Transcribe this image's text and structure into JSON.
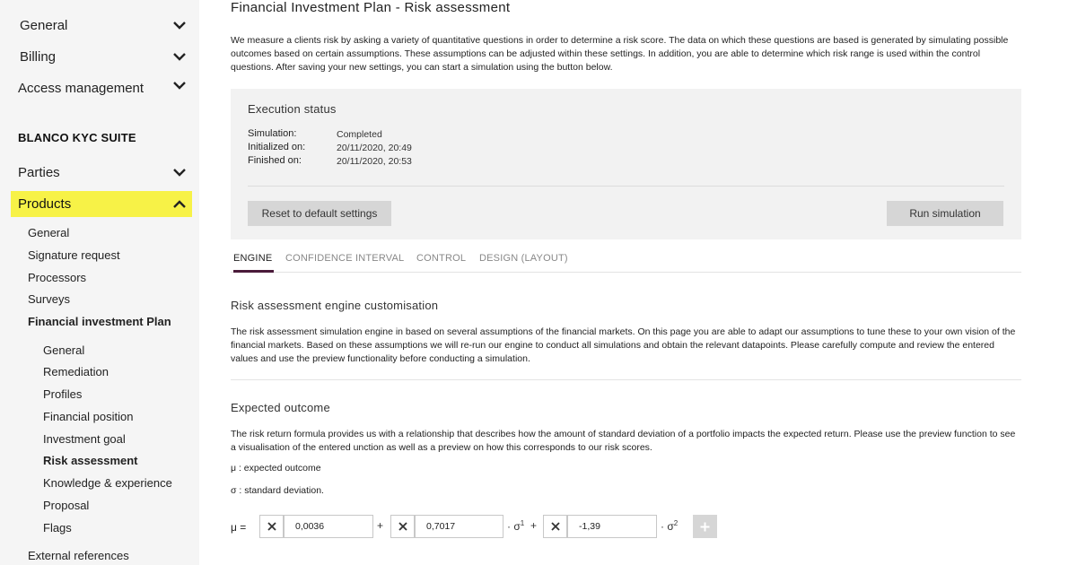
{
  "sidebar": {
    "top_items": [
      {
        "label": "General"
      },
      {
        "label": "Billing"
      },
      {
        "label": "Access management"
      }
    ],
    "suite_title": "BLANCO KYC SUITE",
    "parties": {
      "label": "Parties"
    },
    "products": {
      "label": "Products"
    },
    "product_items": [
      {
        "label": "General"
      },
      {
        "label": "Signature request"
      },
      {
        "label": "Processors"
      },
      {
        "label": "Surveys"
      },
      {
        "label": "Financial investment Plan"
      }
    ],
    "plan_items": [
      {
        "label": "General"
      },
      {
        "label": "Remediation"
      },
      {
        "label": "Profiles"
      },
      {
        "label": "Financial position"
      },
      {
        "label": "Investment goal"
      },
      {
        "label": "Risk assessment"
      },
      {
        "label": "Knowledge & experience"
      },
      {
        "label": "Proposal"
      },
      {
        "label": "Flags"
      }
    ],
    "external_references": {
      "label": "External references"
    },
    "highlight_color": "#f7f247"
  },
  "main": {
    "title": "Financial Investment Plan - Risk assessment",
    "intro": "We measure a clients risk by asking a variety of quantitative questions in order to determine a risk score. The data on which these questions are based is generated by simulating possible outcomes based on certain assumptions. These assumptions can be adjusted within these settings. In addition, you are able to determine which risk range is used within the control questions. After saving your new settings, you can start a simulation using the button below.",
    "execution": {
      "title": "Execution status",
      "rows": [
        {
          "label": "Simulation:",
          "value": "Completed"
        },
        {
          "label": "Initialized on:",
          "value": "20/11/2020, 20:49"
        },
        {
          "label": "Finished on:",
          "value": "20/11/2020, 20:53"
        }
      ],
      "reset_label": "Reset to default settings",
      "run_label": "Run simulation"
    },
    "tabs": [
      {
        "label": "ENGINE"
      },
      {
        "label": "CONFIDENCE INTERVAL"
      },
      {
        "label": "CONTROL"
      },
      {
        "label": "DESIGN (LAYOUT)"
      }
    ],
    "engine_section": {
      "title": "Risk assessment engine customisation",
      "text": "The risk assessment simulation engine in based on several assumptions of the financial markets. On this page you are able to adapt our assumptions to tune these to your own vision of the financial markets. Based on these assumptions we will re-run our engine to conduct all simulations and obtain the relevant datapoints. Please carefully compute and review the entered values and use the preview functionality before conducting a simulation."
    },
    "outcome_section": {
      "title": "Expected outcome",
      "text": "The risk return formula provides us with a relationship that describes how the amount of standard deviation of a portfolio impacts the expected return. Please use the preview function to see a visualisation of the entered unction as well as a preview on how this corresponds to our risk scores.",
      "mu_legend": "μ : expected outcome",
      "sigma_legend": "σ : standard deviation."
    },
    "formula": {
      "mu_eq": "μ =",
      "coef0": "0,0036",
      "coef1": "0,7017",
      "coef2": "-1,39",
      "plus1": "+",
      "term1": "· σ",
      "exp1": "1",
      "plus2": "+",
      "term2": "· σ",
      "exp2": "2"
    },
    "accent_color": "#4a1a3a"
  }
}
